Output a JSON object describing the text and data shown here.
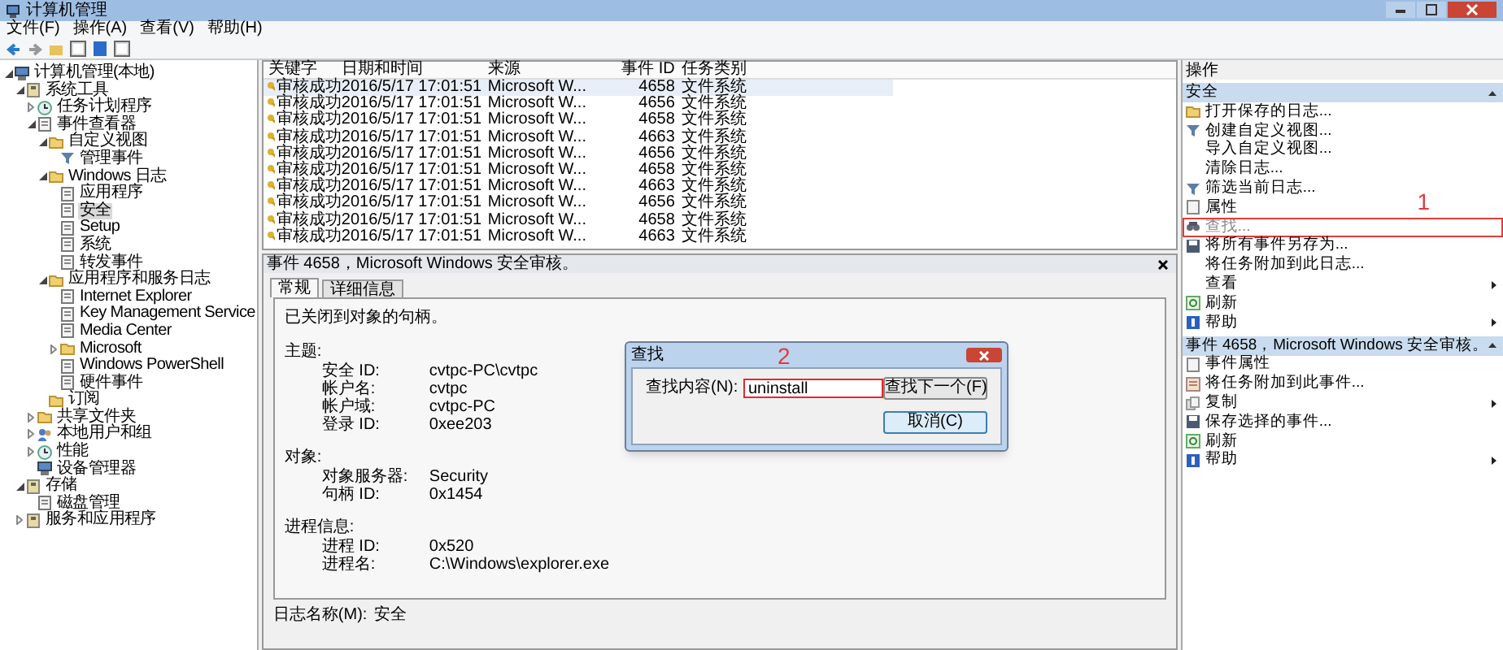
{
  "window": {
    "title": "计算机管理"
  },
  "menu": [
    {
      "label": "文件(F)"
    },
    {
      "label": "操作(A)"
    },
    {
      "label": "查看(V)"
    },
    {
      "label": "帮助(H)"
    }
  ],
  "tree": [
    {
      "label": "计算机管理(本地)",
      "kind": "computer",
      "expanded": true,
      "selected": false,
      "children": [
        {
          "label": "系统工具",
          "kind": "tools",
          "expanded": true,
          "selected": false,
          "children": [
            {
              "label": "任务计划程序",
              "kind": "clock",
              "expanded": false,
              "selected": false
            },
            {
              "label": "事件查看器",
              "kind": "log",
              "expanded": true,
              "selected": false,
              "children": [
                {
                  "label": "自定义视图",
                  "kind": "folder",
                  "expanded": true,
                  "selected": false,
                  "children": [
                    {
                      "label": "管理事件",
                      "kind": "filter",
                      "selected": false
                    }
                  ]
                },
                {
                  "label": "Windows 日志",
                  "kind": "folder",
                  "expanded": true,
                  "selected": false,
                  "children": [
                    {
                      "label": "应用程序",
                      "kind": "log",
                      "selected": false
                    },
                    {
                      "label": "安全",
                      "kind": "log",
                      "selected": true
                    },
                    {
                      "label": "Setup",
                      "kind": "log",
                      "selected": false
                    },
                    {
                      "label": "系统",
                      "kind": "log",
                      "selected": false
                    },
                    {
                      "label": "转发事件",
                      "kind": "log",
                      "selected": false
                    }
                  ]
                },
                {
                  "label": "应用程序和服务日志",
                  "kind": "folder",
                  "expanded": true,
                  "selected": false,
                  "children": [
                    {
                      "label": "Internet Explorer",
                      "kind": "log",
                      "selected": false
                    },
                    {
                      "label": "Key Management Service",
                      "kind": "log",
                      "selected": false
                    },
                    {
                      "label": "Media Center",
                      "kind": "log",
                      "selected": false
                    },
                    {
                      "label": "Microsoft",
                      "kind": "folder",
                      "expanded": false,
                      "selected": false
                    },
                    {
                      "label": "Windows PowerShell",
                      "kind": "log",
                      "selected": false
                    },
                    {
                      "label": "硬件事件",
                      "kind": "log",
                      "selected": false
                    }
                  ]
                },
                {
                  "label": "订阅",
                  "kind": "folder",
                  "selected": false
                }
              ]
            },
            {
              "label": "共享文件夹",
              "kind": "folder",
              "expanded": false,
              "selected": false
            },
            {
              "label": "本地用户和组",
              "kind": "users",
              "expanded": false,
              "selected": false
            },
            {
              "label": "性能",
              "kind": "clock",
              "expanded": false,
              "selected": false
            },
            {
              "label": "设备管理器",
              "kind": "computer",
              "selected": false
            }
          ]
        },
        {
          "label": "存储",
          "kind": "tools",
          "expanded": true,
          "selected": false,
          "children": [
            {
              "label": "磁盘管理",
              "kind": "log",
              "selected": false
            }
          ]
        },
        {
          "label": "服务和应用程序",
          "kind": "tools",
          "expanded": false,
          "selected": false
        }
      ]
    }
  ],
  "events": {
    "columns": [
      "关键字",
      "日期和时间",
      "来源",
      "事件 ID",
      "任务类别"
    ],
    "rows": [
      {
        "cells": [
          "审核成功",
          "2016/5/17 17:01:51",
          "Microsoft W...",
          "4658",
          "文件系统"
        ],
        "selected": true
      },
      {
        "cells": [
          "审核成功",
          "2016/5/17 17:01:51",
          "Microsoft W...",
          "4656",
          "文件系统"
        ],
        "selected": false
      },
      {
        "cells": [
          "审核成功",
          "2016/5/17 17:01:51",
          "Microsoft W...",
          "4658",
          "文件系统"
        ],
        "selected": false
      },
      {
        "cells": [
          "审核成功",
          "2016/5/17 17:01:51",
          "Microsoft W...",
          "4663",
          "文件系统"
        ],
        "selected": false
      },
      {
        "cells": [
          "审核成功",
          "2016/5/17 17:01:51",
          "Microsoft W...",
          "4656",
          "文件系统"
        ],
        "selected": false
      },
      {
        "cells": [
          "审核成功",
          "2016/5/17 17:01:51",
          "Microsoft W...",
          "4658",
          "文件系统"
        ],
        "selected": false
      },
      {
        "cells": [
          "审核成功",
          "2016/5/17 17:01:51",
          "Microsoft W...",
          "4663",
          "文件系统"
        ],
        "selected": false
      },
      {
        "cells": [
          "审核成功",
          "2016/5/17 17:01:51",
          "Microsoft W...",
          "4656",
          "文件系统"
        ],
        "selected": false
      },
      {
        "cells": [
          "审核成功",
          "2016/5/17 17:01:51",
          "Microsoft W...",
          "4658",
          "文件系统"
        ],
        "selected": false
      },
      {
        "cells": [
          "审核成功",
          "2016/5/17 17:01:51",
          "Microsoft W...",
          "4663",
          "文件系统"
        ],
        "selected": false
      }
    ]
  },
  "detail": {
    "title": "事件 4658，Microsoft Windows 安全审核。",
    "tabs": [
      {
        "label": "常规",
        "selected": true
      },
      {
        "label": "详细信息",
        "selected": false
      }
    ],
    "message": "已关闭到对象的句柄。",
    "sections": [
      {
        "heading": "主题:",
        "fields": [
          {
            "label": "安全 ID:",
            "value": "cvtpc-PC\\cvtpc"
          },
          {
            "label": "帐户名:",
            "value": "cvtpc"
          },
          {
            "label": "帐户域:",
            "value": "cvtpc-PC"
          },
          {
            "label": "登录 ID:",
            "value": "0xee203"
          }
        ]
      },
      {
        "heading": "对象:",
        "fields": [
          {
            "label": "对象服务器:",
            "value": "Security"
          },
          {
            "label": "句柄 ID:",
            "value": "0x1454"
          }
        ]
      },
      {
        "heading": "进程信息:",
        "fields": [
          {
            "label": "进程 ID:",
            "value": "0x520"
          },
          {
            "label": "进程名:",
            "value": "C:\\Windows\\explorer.exe"
          }
        ]
      }
    ],
    "log_name": {
      "label": "日志名称(M):",
      "value": "安全"
    }
  },
  "find_dialog": {
    "title": "查找",
    "annotation": "2",
    "label": "查找内容(N):",
    "value": "uninstall",
    "buttons": [
      "查找下一个(F)",
      "取消(C)"
    ]
  },
  "actions": {
    "title": "操作",
    "annotation": "1",
    "groups": [
      {
        "title": "安全",
        "expanded": true,
        "items": [
          {
            "label": "打开保存的日志...",
            "kind": "folder",
            "submenu": false,
            "highlighted": false
          },
          {
            "label": "创建自定义视图...",
            "kind": "filter",
            "submenu": false,
            "highlighted": false
          },
          {
            "label": "导入自定义视图...",
            "kind": "none",
            "submenu": false,
            "highlighted": false
          },
          {
            "label": "清除日志...",
            "kind": "none",
            "submenu": false,
            "highlighted": false
          },
          {
            "label": "筛选当前日志...",
            "kind": "filter",
            "submenu": false,
            "highlighted": false
          },
          {
            "label": "属性",
            "kind": "page",
            "submenu": false,
            "highlighted": false
          },
          {
            "label": "查找...",
            "kind": "find",
            "submenu": false,
            "highlighted": true
          },
          {
            "label": "将所有事件另存为...",
            "kind": "save",
            "submenu": false,
            "highlighted": false
          },
          {
            "label": "将任务附加到此日志...",
            "kind": "none",
            "submenu": false,
            "highlighted": false
          },
          {
            "label": "查看",
            "kind": "none",
            "submenu": true,
            "highlighted": false
          },
          {
            "label": "刷新",
            "kind": "refresh",
            "submenu": false,
            "highlighted": false
          },
          {
            "label": "帮助",
            "kind": "help",
            "submenu": true,
            "highlighted": false
          }
        ]
      },
      {
        "title": "事件 4658，Microsoft Windows 安全审核。",
        "expanded": true,
        "items": [
          {
            "label": "事件属性",
            "kind": "page",
            "submenu": false,
            "highlighted": false
          },
          {
            "label": "将任务附加到此事件...",
            "kind": "attach",
            "submenu": false,
            "highlighted": false
          },
          {
            "label": "复制",
            "kind": "copy",
            "submenu": true,
            "highlighted": false
          },
          {
            "label": "保存选择的事件...",
            "kind": "save",
            "submenu": false,
            "highlighted": false
          },
          {
            "label": "刷新",
            "kind": "refresh",
            "submenu": false,
            "highlighted": false
          },
          {
            "label": "帮助",
            "kind": "help",
            "submenu": true,
            "highlighted": false
          }
        ]
      }
    ]
  }
}
